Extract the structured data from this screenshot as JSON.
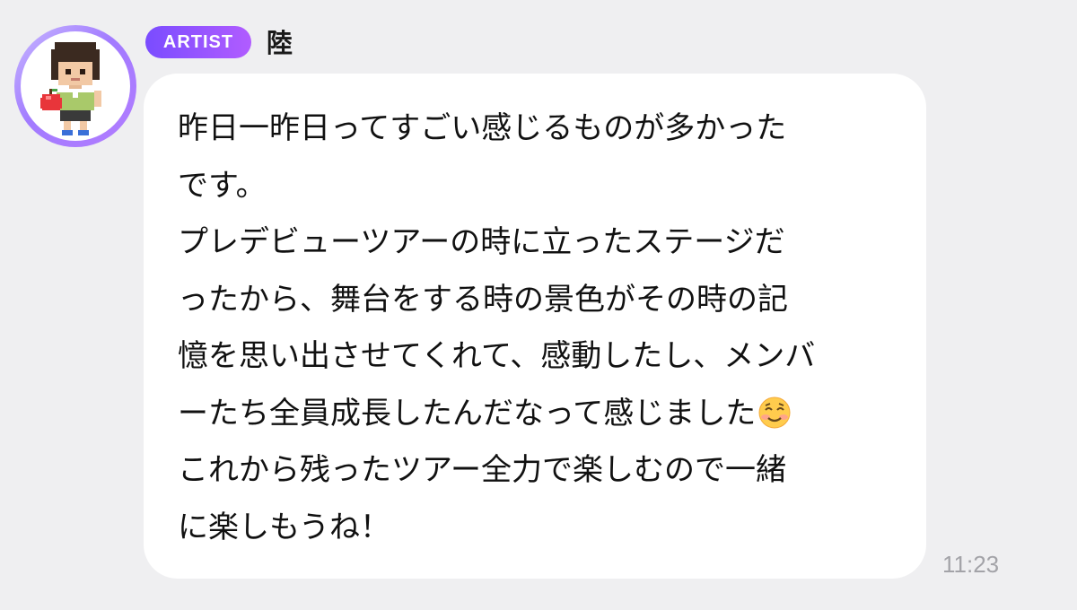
{
  "sender": {
    "badge": "ARTIST",
    "name": "陸",
    "avatar_icon": "pixel-art-boy-holding-apple"
  },
  "message": {
    "lines": [
      "昨日一昨日ってすごい感じるものが多かった",
      "です。",
      "プレデビューツアーの時に立ったステージだ",
      "ったから、舞台をする時の景色がその時の記",
      "憶を思い出させてくれて、感動したし、メンバ",
      "ーたち全員成長したんだなって感じました",
      "これから残ったツアー全力で楽しむので一緒",
      "に楽しもうね！"
    ],
    "emoji": "smiling-face-emoji",
    "time": "11:23"
  },
  "colors": {
    "background": "#efeff1",
    "bubble": "#ffffff",
    "badge_start": "#7a4cff",
    "badge_end": "#b15cff",
    "time": "#a3a3a8"
  }
}
